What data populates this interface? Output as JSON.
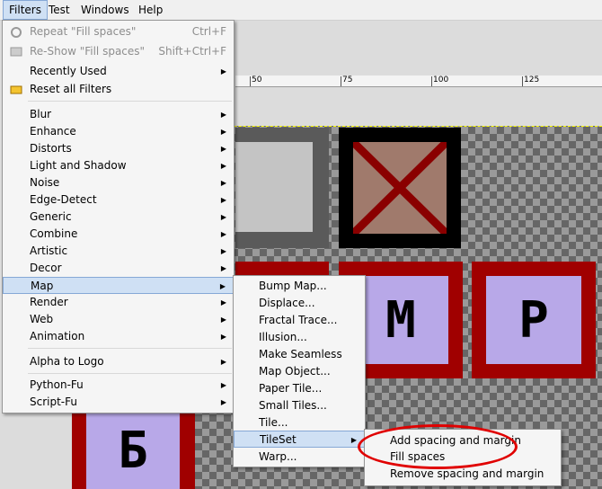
{
  "menubar": {
    "items": [
      {
        "label": "Filters",
        "underline": "F"
      },
      {
        "label": "Test"
      },
      {
        "label": "Windows",
        "underline": "W"
      },
      {
        "label": "Help",
        "underline": "H"
      }
    ]
  },
  "ruler": {
    "labels": [
      "50",
      "75",
      "100",
      "125"
    ]
  },
  "canvas": {
    "tiles": {
      "m": "M",
      "p": "P",
      "b": "Б"
    }
  },
  "filters_menu": {
    "repeat": {
      "label": "Repeat \"Fill spaces\"",
      "shortcut": "Ctrl+F"
    },
    "reshow": {
      "label": "Re-Show \"Fill spaces\"",
      "shortcut": "Shift+Ctrl+F"
    },
    "recently_used": "Recently Used",
    "reset": "Reset all Filters",
    "items": [
      "Blur",
      "Enhance",
      "Distorts",
      "Light and Shadow",
      "Noise",
      "Edge-Detect",
      "Generic",
      "Combine",
      "Artistic",
      "Decor",
      "Map",
      "Render",
      "Web",
      "Animation"
    ],
    "alpha_to_logo": "Alpha to Logo",
    "python_fu": "Python-Fu",
    "script_fu": "Script-Fu"
  },
  "map_menu": {
    "items": [
      "Bump Map...",
      "Displace...",
      "Fractal Trace...",
      "Illusion...",
      "Make Seamless",
      "Map Object...",
      "Paper Tile...",
      "Small Tiles...",
      "Tile...",
      "TileSet",
      "Warp..."
    ]
  },
  "tileset_menu": {
    "items": [
      "Add spacing and margin",
      "Fill spaces",
      "Remove spacing and margin"
    ]
  },
  "colors": {
    "highlight": "#cfe0f4",
    "annotation": "#e00000",
    "tile_red": "#a00000",
    "tile_lilac": "#b8a8e8"
  }
}
